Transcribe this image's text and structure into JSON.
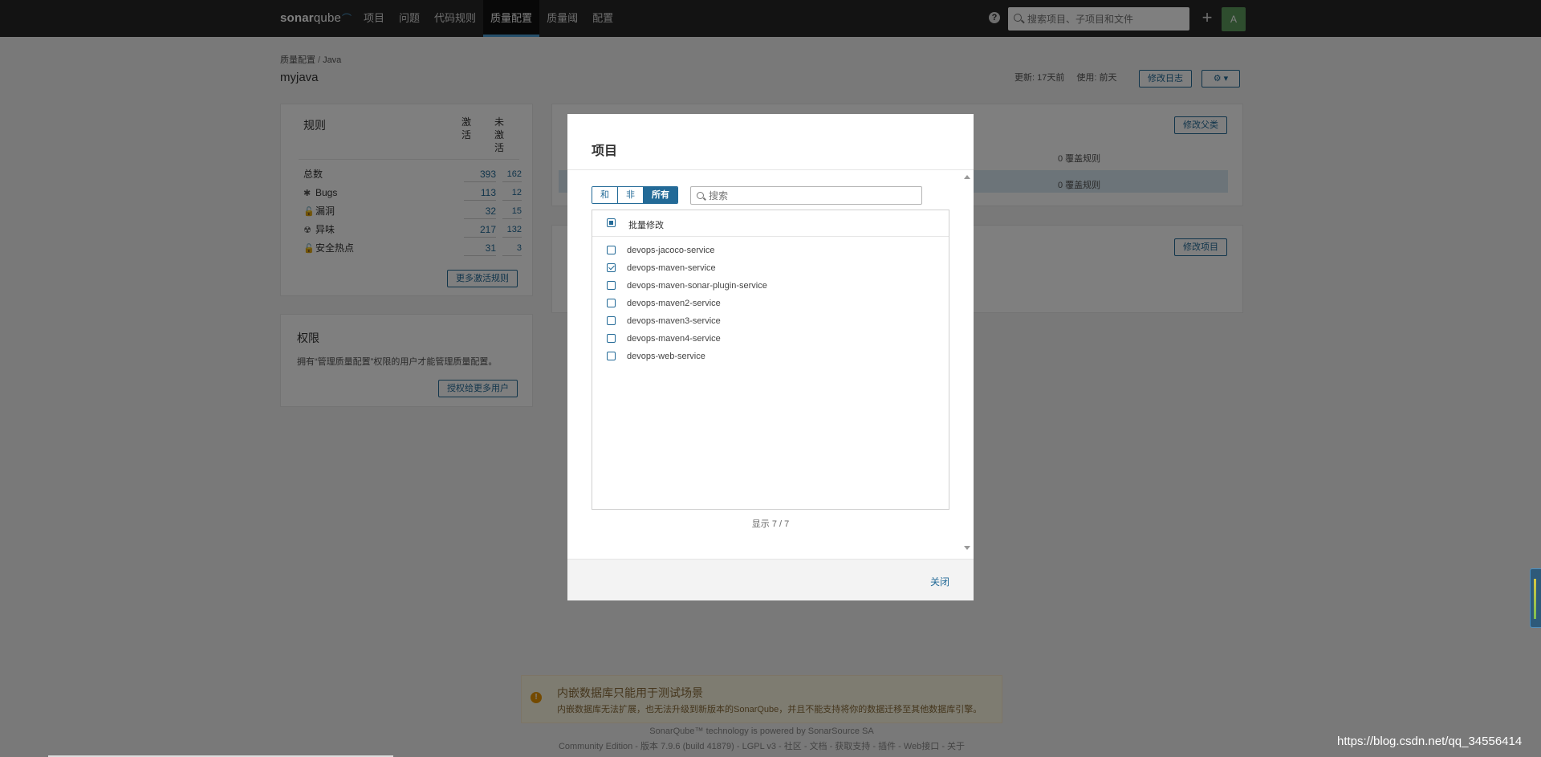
{
  "app": {
    "logo_main": "sonar",
    "logo_sub": "qube"
  },
  "nav": {
    "items": [
      "项目",
      "问题",
      "代码规则",
      "质量配置",
      "质量阈",
      "配置"
    ],
    "active_index": 3,
    "help_glyph": "?",
    "search_placeholder": "搜索项目、子项目和文件",
    "plus_glyph": "+",
    "avatar_letter": "A"
  },
  "page": {
    "breadcrumb_root": "质量配置",
    "breadcrumb_sep": "/",
    "breadcrumb_lang": "Java",
    "title": "myjava",
    "updated": "更新: 17天前",
    "used": "使用: 前天",
    "changelog_btn": "修改日志",
    "gear_btn": "⚙ ▾"
  },
  "rules": {
    "title": "规则",
    "col_active": "激活",
    "col_inactive": "未激活",
    "rows": [
      {
        "icon": "",
        "label": "总数",
        "active": "393",
        "inactive": "162"
      },
      {
        "icon": "bug-icon",
        "glyph": "✱",
        "label": "Bugs",
        "active": "113",
        "inactive": "12"
      },
      {
        "icon": "lock-icon",
        "glyph": "🔓",
        "label": "漏洞",
        "active": "32",
        "inactive": "15"
      },
      {
        "icon": "radiation-icon",
        "glyph": "☢",
        "label": "异味",
        "active": "217",
        "inactive": "132"
      },
      {
        "icon": "security-hotspot-icon",
        "glyph": "🔓",
        "label": "安全热点",
        "active": "31",
        "inactive": "3"
      }
    ],
    "more_btn": "更多激活规则"
  },
  "permissions": {
    "title": "权限",
    "text": "拥有“管理质量配置”权限的用户才能管理质量配置。",
    "grant_btn": "授权给更多用户"
  },
  "inheritance": {
    "change_parent_btn": "修改父类",
    "override_1": "0 覆盖规则",
    "override_2": "0 覆盖规则"
  },
  "projects_card": {
    "change_projects_btn": "修改项目"
  },
  "modal": {
    "title": "项目",
    "filters": [
      "和",
      "非",
      "所有"
    ],
    "active_filter": 2,
    "search_placeholder": "搜索",
    "bulk_label": "批量修改",
    "projects": [
      {
        "name": "devops-jacoco-service",
        "checked": false
      },
      {
        "name": "devops-maven-service",
        "checked": true
      },
      {
        "name": "devops-maven-sonar-plugin-service",
        "checked": false
      },
      {
        "name": "devops-maven2-service",
        "checked": false
      },
      {
        "name": "devops-maven3-service",
        "checked": false
      },
      {
        "name": "devops-maven4-service",
        "checked": false
      },
      {
        "name": "devops-web-service",
        "checked": false
      }
    ],
    "shown": "显示 7 / 7",
    "close": "关闭"
  },
  "warning": {
    "glyph": "!",
    "title": "内嵌数据库只能用于测试场景",
    "text": "内嵌数据库无法扩展，也无法升级到新版本的SonarQube，并且不能支持将你的数据迁移至其他数据库引擎。"
  },
  "footer": {
    "line1": "SonarQube™ technology is powered by SonarSource SA",
    "line2": "Community Edition - 版本 7.9.6 (build 41879) - LGPL v3 - 社区 - 文档 - 获取支持 - 插件 - Web接口 - 关于"
  },
  "watermark": "https://blog.csdn.net/qq_34556414",
  "colors": {
    "primary": "#236a97",
    "topbar": "#262626",
    "highlight": "#d8e9f3"
  }
}
